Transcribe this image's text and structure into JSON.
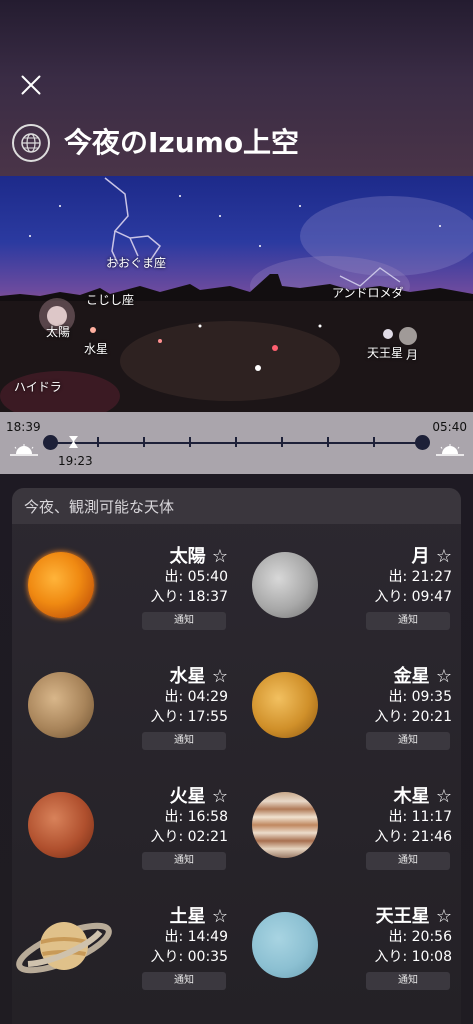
{
  "header": {
    "title": "今夜のIzumo上空"
  },
  "sky_labels": {
    "ursa_major": "おおぐま座",
    "leo_minor": "こじし座",
    "andromeda": "アンドロメダ",
    "sun": "太陽",
    "mercury": "水星",
    "uranus": "天王星",
    "moon": "月",
    "hydra": "ハイドラ"
  },
  "timeline": {
    "sunset": "18:39",
    "sunrise": "05:40",
    "current": "19:23",
    "progress_fraction": 0.07
  },
  "panel": {
    "title": "今夜、観測可能な天体"
  },
  "bodies": [
    {
      "name": "太陽 ☆",
      "rise": "出: 05:40",
      "set": "入り: 18:37",
      "notify": "通知"
    },
    {
      "name": "月 ☆",
      "rise": "出: 21:27",
      "set": "入り: 09:47",
      "notify": "通知"
    },
    {
      "name": "水星 ☆",
      "rise": "出: 04:29",
      "set": "入り: 17:55",
      "notify": "通知"
    },
    {
      "name": "金星 ☆",
      "rise": "出: 09:35",
      "set": "入り: 20:21",
      "notify": "通知"
    },
    {
      "name": "火星 ☆",
      "rise": "出: 16:58",
      "set": "入り: 02:21",
      "notify": "通知"
    },
    {
      "name": "木星 ☆",
      "rise": "出: 11:17",
      "set": "入り: 21:46",
      "notify": "通知"
    },
    {
      "name": "土星 ☆",
      "rise": "出: 14:49",
      "set": "入り: 00:35",
      "notify": "通知"
    },
    {
      "name": "天王星 ☆",
      "rise": "出: 20:56",
      "set": "入り: 10:08",
      "notify": "通知"
    }
  ]
}
